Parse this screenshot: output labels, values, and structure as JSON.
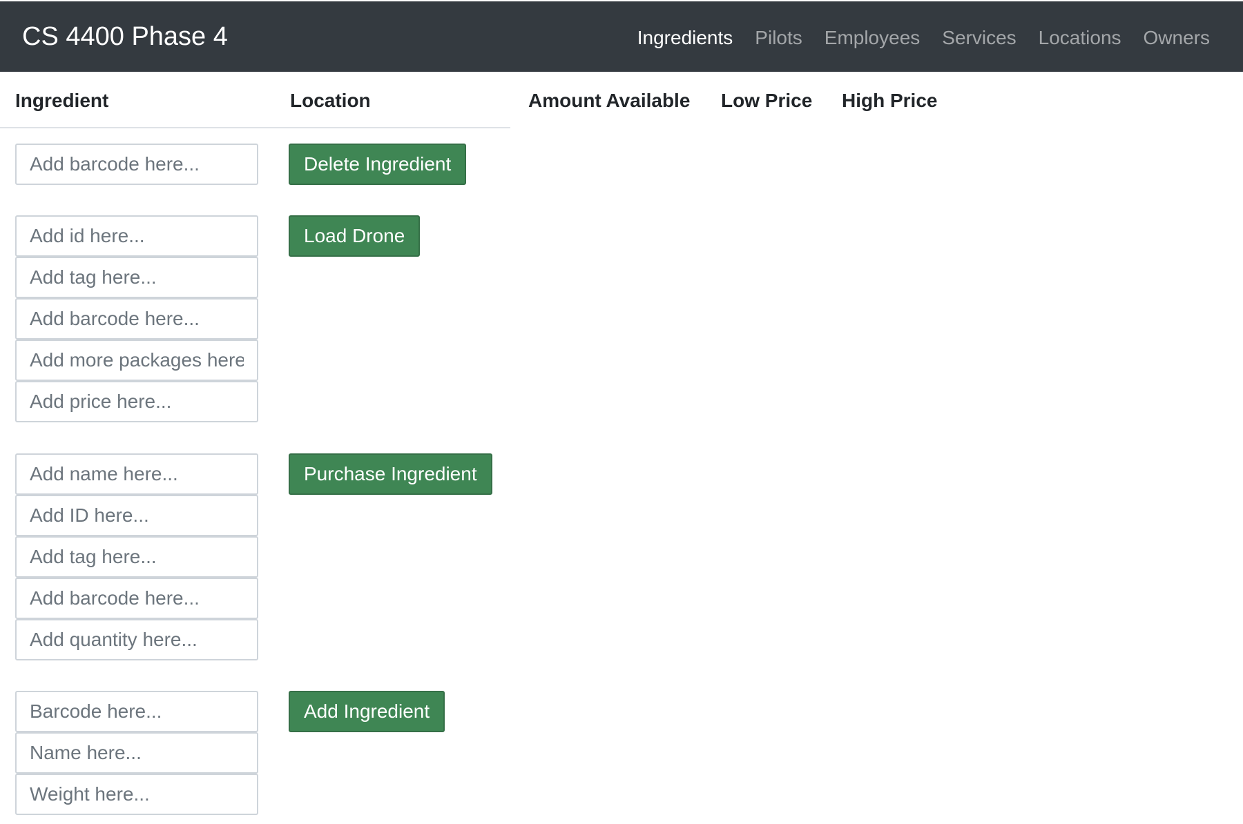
{
  "navbar": {
    "brand": "CS 4400 Phase 4",
    "links": [
      {
        "label": "Ingredients",
        "active": true
      },
      {
        "label": "Pilots",
        "active": false
      },
      {
        "label": "Employees",
        "active": false
      },
      {
        "label": "Services",
        "active": false
      },
      {
        "label": "Locations",
        "active": false
      },
      {
        "label": "Owners",
        "active": false
      }
    ]
  },
  "table": {
    "headers": [
      "Ingredient",
      "Location",
      "Amount Available",
      "Low Price",
      "High Price"
    ]
  },
  "forms": {
    "delete": {
      "barcode_placeholder": "Add barcode here...",
      "button": "Delete Ingredient"
    },
    "load": {
      "id_placeholder": "Add id here...",
      "tag_placeholder": "Add tag here...",
      "barcode_placeholder": "Add barcode here...",
      "packages_placeholder": "Add more packages here...",
      "price_placeholder": "Add price here...",
      "button": "Load Drone"
    },
    "purchase": {
      "name_placeholder": "Add name here...",
      "id_placeholder": "Add ID here...",
      "tag_placeholder": "Add tag here...",
      "barcode_placeholder": "Add barcode here...",
      "quantity_placeholder": "Add quantity here...",
      "button": "Purchase Ingredient"
    },
    "add": {
      "barcode_placeholder": "Barcode here...",
      "name_placeholder": "Name here...",
      "weight_placeholder": "Weight here...",
      "button": "Add Ingredient"
    }
  },
  "colors": {
    "navbar_bg": "#343a40",
    "button_bg": "#3f8654"
  }
}
